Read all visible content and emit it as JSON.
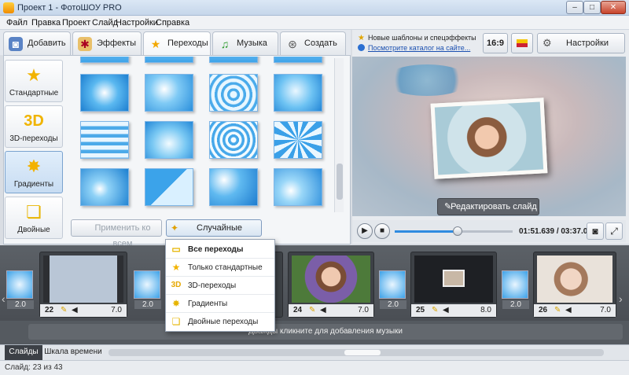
{
  "window": {
    "title": "Проект 1 - ФотоШОУ PRO",
    "minimize": "–",
    "maximize": "□",
    "close": "✕"
  },
  "menu": [
    "Файл",
    "Правка",
    "Проект",
    "Слайд",
    "Настройки",
    "Справка"
  ],
  "tabs": [
    {
      "label": "Добавить",
      "icon": "camera-icon"
    },
    {
      "label": "Эффекты",
      "icon": "palette-icon"
    },
    {
      "label": "Переходы",
      "icon": "star-icon"
    },
    {
      "label": "Музыка",
      "icon": "music-icon"
    },
    {
      "label": "Создать",
      "icon": "film-reel-icon"
    }
  ],
  "categories": [
    {
      "label": "Стандартные"
    },
    {
      "label": "3D-переходы"
    },
    {
      "label": "Градиенты"
    },
    {
      "label": "Двойные"
    }
  ],
  "buttons": {
    "apply_all": "Применить ко всем",
    "random": "Случайные переходы"
  },
  "news": {
    "title": "Новые шаблоны и спецэффекты",
    "link": "Посмотрите каталог на сайте..."
  },
  "toolbar": {
    "ratio": "16:9",
    "settings": "Настройки проекта"
  },
  "preview": {
    "edit_button": "Редактировать слайд"
  },
  "player": {
    "time": "01:51.639 / 03:37.000",
    "progress": 0.53
  },
  "slides": [
    {
      "num": "22",
      "dur": "7.0",
      "trans": "2.0"
    },
    {
      "num": "23",
      "dur": "",
      "trans": "2.0"
    },
    {
      "num": "24",
      "dur": "7.0",
      "trans": "2.0"
    },
    {
      "num": "25",
      "dur": "8.0",
      "trans": "2.0"
    },
    {
      "num": "26",
      "dur": "7.0",
      "trans": "2.0"
    }
  ],
  "first_trans": "2.0",
  "music_hint": "Дважды кликните для добавления музыки",
  "dropdown": [
    {
      "label": "Все переходы",
      "bold": true
    },
    {
      "label": "Только стандартные"
    },
    {
      "label": "3D-переходы"
    },
    {
      "label": "Градиенты"
    },
    {
      "label": "Двойные переходы"
    }
  ],
  "bottom_tabs": [
    "Слайды",
    "Шкала времени"
  ],
  "status": "Слайд: 23 из 43"
}
